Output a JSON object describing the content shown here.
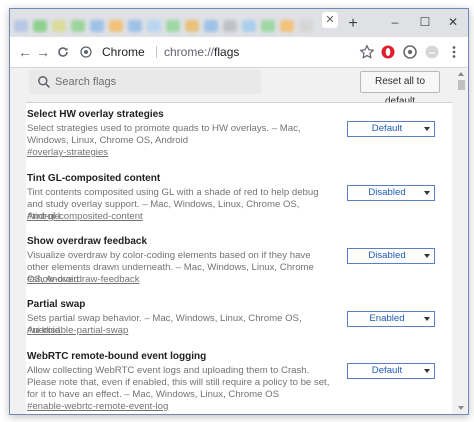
{
  "window": {
    "controls": {
      "minimize": "–",
      "maximize": "☐",
      "close": "✕"
    }
  },
  "tabs": {
    "favicon_colors": [
      "#b8c7e6",
      "#8fd08f",
      "#d9dc9a",
      "#9bd59b",
      "#9ec1e8",
      "#f2c27a",
      "#9ec1e8",
      "#b8d6f0",
      "#9ed8a4",
      "#e8c27a",
      "#9ec1e8",
      "#bfc2c8",
      "#a9cfee",
      "#9ed8a4",
      "#f2c27a",
      "#d6d6d6"
    ],
    "close": "✕",
    "new_tab": "+"
  },
  "toolbar": {
    "back": "←",
    "forward": "→",
    "reload": "C",
    "origin_chip": "Chrome",
    "url_host": "chrome://",
    "url_path": "flags",
    "bookmark_icon": "star-icon",
    "extension_icons": [
      "opera-icon",
      "extension-icon",
      "profile-avatar-icon",
      "menu-icon"
    ]
  },
  "search": {
    "placeholder": "Search flags",
    "value": ""
  },
  "reset_button": "Reset all to default",
  "flags": [
    {
      "title": "Select HW overlay strategies",
      "desc": "Select strategies used to promote quads to HW overlays. – Mac, Windows, Linux, Chrome OS, Android",
      "link": "#overlay-strategies",
      "value": "Default"
    },
    {
      "title": "Tint GL-composited content",
      "desc": "Tint contents composited using GL with a shade of red to help debug and study overlay support. – Mac, Windows, Linux, Chrome OS, Android",
      "link": "#tint-gl-composited-content",
      "value": "Disabled"
    },
    {
      "title": "Show overdraw feedback",
      "desc": "Visualize overdraw by color-coding elements based on if they have other elements drawn underneath. – Mac, Windows, Linux, Chrome OS, Android",
      "link": "#show-overdraw-feedback",
      "value": "Disabled"
    },
    {
      "title": "Partial swap",
      "desc": "Sets partial swap behavior. – Mac, Windows, Linux, Chrome OS, Android",
      "link": "#ui-disable-partial-swap",
      "value": "Enabled"
    },
    {
      "title": "WebRTC remote-bound event logging",
      "desc": "Allow collecting WebRTC event logs and uploading them to Crash. Please note that, even if enabled, this will still require a policy to be set, for it to have an effect. – Mac, Windows, Linux, Chrome OS",
      "link": "#enable-webrtc-remote-event-log",
      "value": "Default"
    }
  ]
}
